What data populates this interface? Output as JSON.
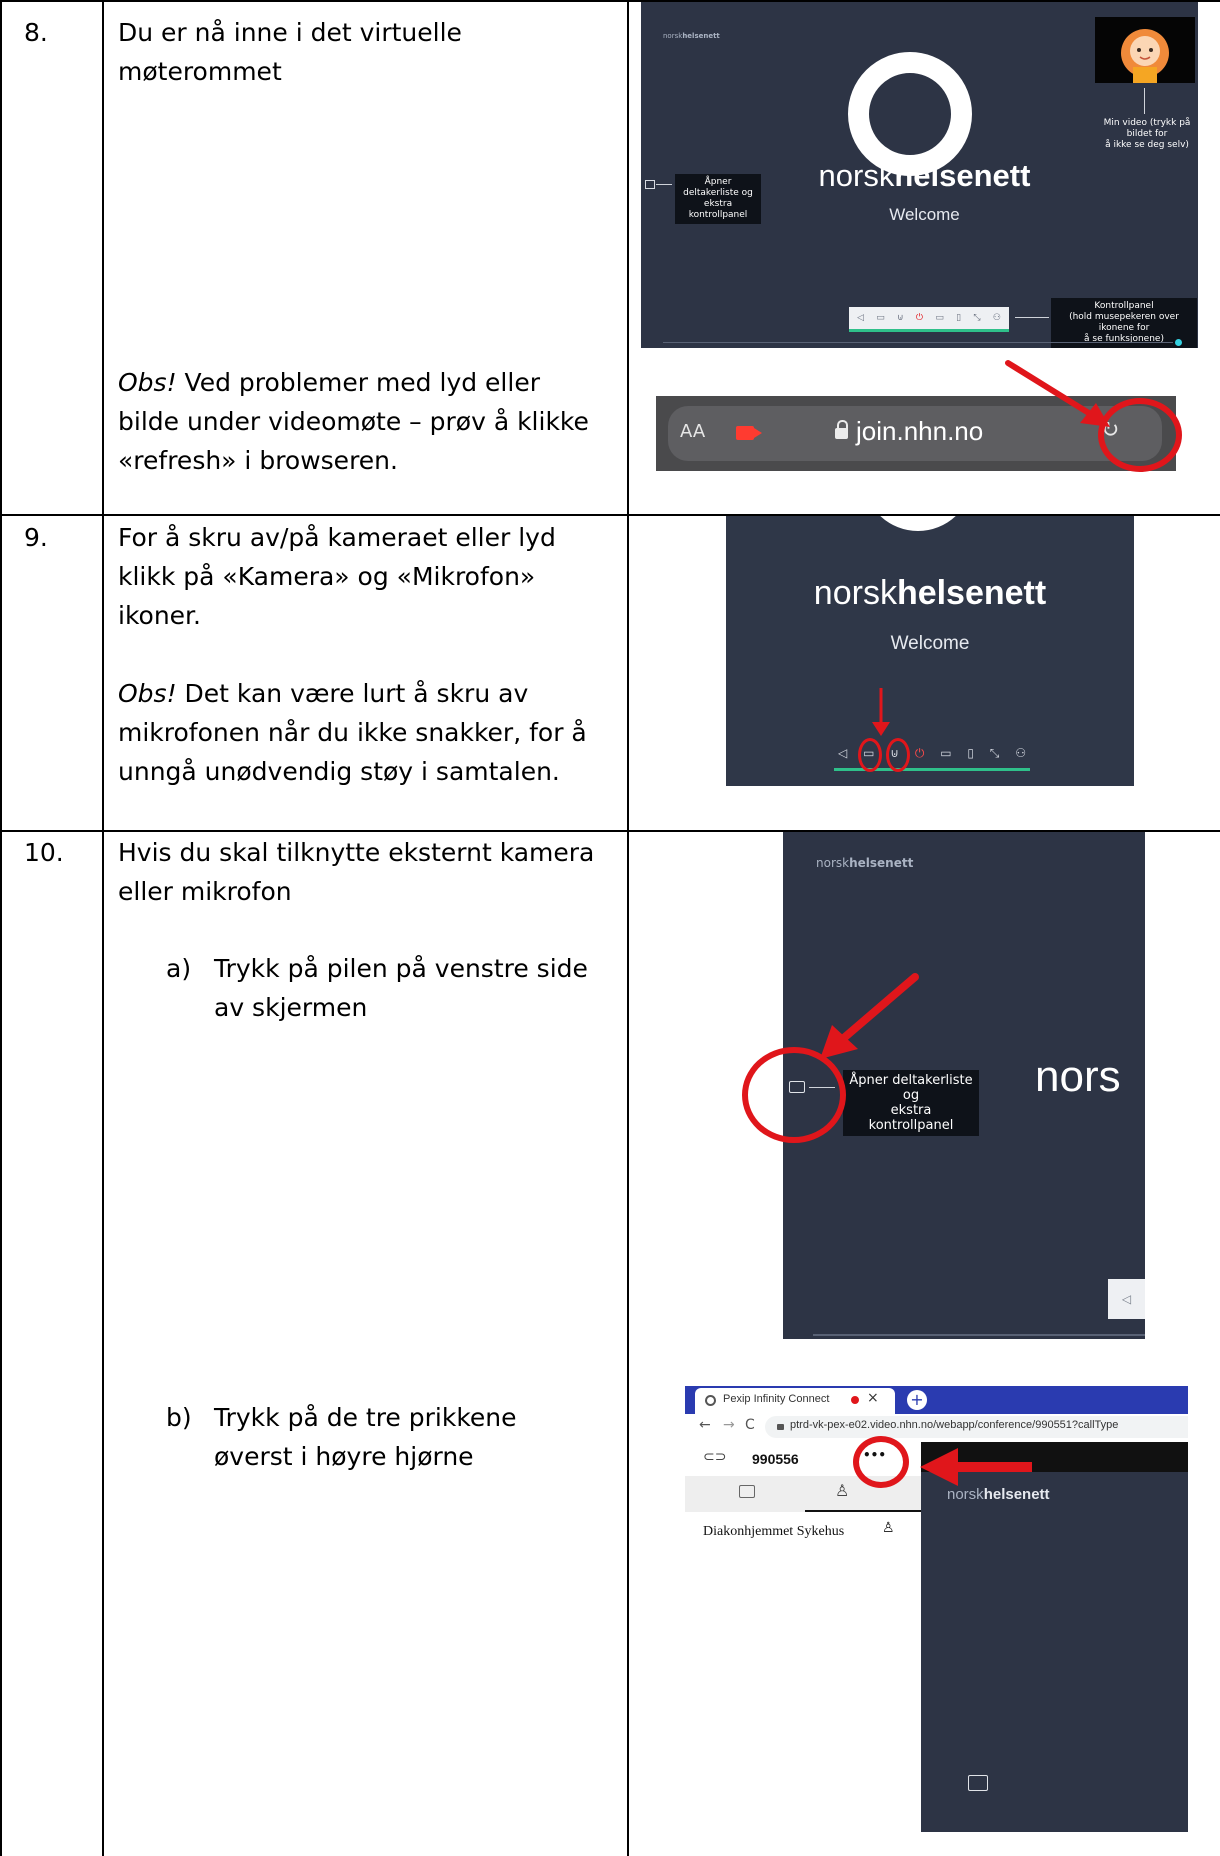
{
  "rows": [
    {
      "number": "8.",
      "text_line1": "Du er nå inne i det virtuelle",
      "text_line2": "møterommet",
      "obs_label": "Obs!",
      "obs_line1_rest": " Ved problemer med lyd eller",
      "obs_line2": "bilde under videomøte – prøv å klikke",
      "obs_line3": "«refresh» i browseren."
    },
    {
      "number": "9.",
      "line1": "For å skru av/på kameraet eller lyd",
      "line2": "klikk på «Kamera» og «Mikrofon»",
      "line3": "ikoner.",
      "obs_label": "Obs!",
      "obs_line1_rest": " Det kan være lurt å skru av",
      "obs_line2": "mikrofonen når du ikke snakker, for å",
      "obs_line3": "unngå unødvendig støy i samtalen."
    },
    {
      "number": "10.",
      "line1": "Hvis du skal tilknytte eksternt kamera",
      "line2": "eller mikrofon",
      "step_a_marker": "a)",
      "step_a_line1": "Trykk på pilen på venstre side",
      "step_a_line2": "av skjermen",
      "step_b_marker": "b)",
      "step_b_line1": "Trykk på de tre prikkene",
      "step_b_line2": "øverst i høyre hjørne"
    }
  ],
  "screenshots": {
    "meeting_room": {
      "corner_logo_light": "norsk",
      "corner_logo_bold": "helsenett",
      "brand_light": "norsk",
      "brand_bold": "helsenett",
      "welcome": "Welcome",
      "tip_participants_line1": "Åpner deltakerliste og",
      "tip_participants_line2": "ekstra kontrollpanel",
      "tip_video_line1": "Min video (trykk på bildet for",
      "tip_video_line2": "å ikke se deg selv)",
      "tip_control_line1": "Kontrollpanel",
      "tip_control_line2": "(hold musepekeren over ikonene for",
      "tip_control_line3": "å se funksjonene)"
    },
    "browser_bar": {
      "text_size": "AA",
      "url": "join.nhn.no"
    },
    "mic_cam": {
      "brand_light": "norsk",
      "brand_bold": "helsenett",
      "welcome": "Welcome"
    },
    "side_arrow": {
      "corner_logo_light": "norsk",
      "corner_logo_bold": "helsenett",
      "tip_line1": "Åpner deltakerliste og",
      "tip_line2": "ekstra kontrollpanel",
      "brand_partial": "nors"
    },
    "pexip": {
      "tab_title": "Pexip Infinity Connect",
      "tab_close": "×",
      "new_tab": "+",
      "url": "ptrd-vk-pex-e02.video.nhn.no/webapp/conference/990551?callType",
      "conference_id": "990556",
      "menu_dots": "•••",
      "participant": "Diakonhjemmet Sykehus",
      "brand_light": "norsk",
      "brand_bold": "helsenett"
    }
  },
  "colors": {
    "panel_navy": "#2f3748",
    "annotation_red": "#e0161b",
    "accent_green": "#2fc08a"
  }
}
